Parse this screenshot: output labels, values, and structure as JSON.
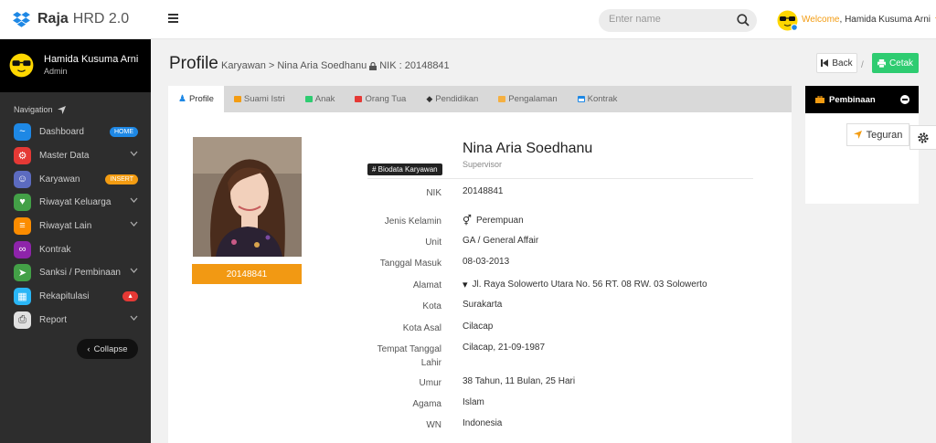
{
  "brand": {
    "name_bold": "Raja",
    "name_rest": "HRD 2.0"
  },
  "search": {
    "placeholder": "Enter name"
  },
  "header": {
    "welcome": "Welcome",
    "sep": ",",
    "user": "Hamida Kusuma Arni"
  },
  "sidebar": {
    "user_name": "Hamida Kusuma Arni",
    "user_role": "Admin",
    "nav_heading": "Navigation",
    "items": [
      {
        "label": "Dashboard",
        "icon": "pulse-icon",
        "color": "#1e88e5",
        "badge": "HOME",
        "badge_color": "#1e88e5"
      },
      {
        "label": "Master Data",
        "icon": "gear-icon",
        "color": "#e53935",
        "chevron": true
      },
      {
        "label": "Karyawan",
        "icon": "user-icon",
        "color": "#5c6bc0",
        "badge": "INSERT",
        "badge_color": "#f39c12"
      },
      {
        "label": "Riwayat Keluarga",
        "icon": "family-icon",
        "color": "#43a047",
        "chevron": true
      },
      {
        "label": "Riwayat Lain",
        "icon": "list-icon",
        "color": "#fb8c00",
        "chevron": true
      },
      {
        "label": "Kontrak",
        "icon": "rings-icon",
        "color": "#8e24aa"
      },
      {
        "label": "Sanksi / Pembinaan",
        "icon": "send-icon",
        "color": "#43a047",
        "chevron": true
      },
      {
        "label": "Rekapitulasi",
        "icon": "table-icon",
        "color": "#29b6f6",
        "badge": "▲",
        "badge_color": "#e53935"
      },
      {
        "label": "Report",
        "icon": "printer-icon",
        "color": "#e0e0e0",
        "chevron": true
      }
    ],
    "collapse": "Collapse"
  },
  "page": {
    "title": "Profile",
    "crumb_section": "Karyawan",
    "crumb_sep": ">",
    "crumb_name": "Nina Aria Soedhanu",
    "crumb_nik": "NIK : 20148841",
    "back": "Back",
    "print": "Cetak",
    "slash": "/"
  },
  "tabs": [
    {
      "label": "Profile",
      "active": true,
      "icon": "user-icon",
      "color": "#1e88e5"
    },
    {
      "label": "Suami Istri",
      "icon": "square-icon",
      "color": "#f39c12"
    },
    {
      "label": "Anak",
      "icon": "square-icon",
      "color": "#2ecc71"
    },
    {
      "label": "Orang Tua",
      "icon": "square-icon",
      "color": "#e53935"
    },
    {
      "label": "Pendidikan",
      "icon": "graduation-cap-icon",
      "color": "#333"
    },
    {
      "label": "Pengalaman",
      "icon": "square-icon",
      "color": "#f5b041"
    },
    {
      "label": "Kontrak",
      "icon": "calendar-icon",
      "color": "#1e88e5"
    }
  ],
  "profile": {
    "name": "Nina Aria Soedhanu",
    "position": "Supervisor",
    "badge": "# Biodata Karyawan",
    "nik_bar": "20148841",
    "fields": [
      {
        "key": "NIK",
        "value": "20148841"
      },
      {
        "key": "Jenis Kelamin",
        "value": "Perempuan",
        "icon": "gender-icon"
      },
      {
        "key": "Unit",
        "value": "GA / General Affair"
      },
      {
        "key": "Tanggal Masuk",
        "value": "08-03-2013"
      },
      {
        "key": "Alamat",
        "value": "Jl. Raya Solowerto Utara No. 56 RT. 08 RW. 03 Solowerto",
        "icon": "map-pin-icon"
      },
      {
        "key": "Kota",
        "value": "Surakarta"
      },
      {
        "key": "Kota Asal",
        "value": "Cilacap"
      },
      {
        "key": "Tempat Tanggal Lahir",
        "value": "Cilacap, 21-09-1987"
      },
      {
        "key": "Umur",
        "value": "38 Tahun, 11 Bulan, 25 Hari"
      },
      {
        "key": "Agama",
        "value": "Islam"
      },
      {
        "key": "WN",
        "value": "Indonesia"
      }
    ]
  },
  "pembinaan": {
    "title": "Pembinaan",
    "teguran": "Teguran"
  }
}
